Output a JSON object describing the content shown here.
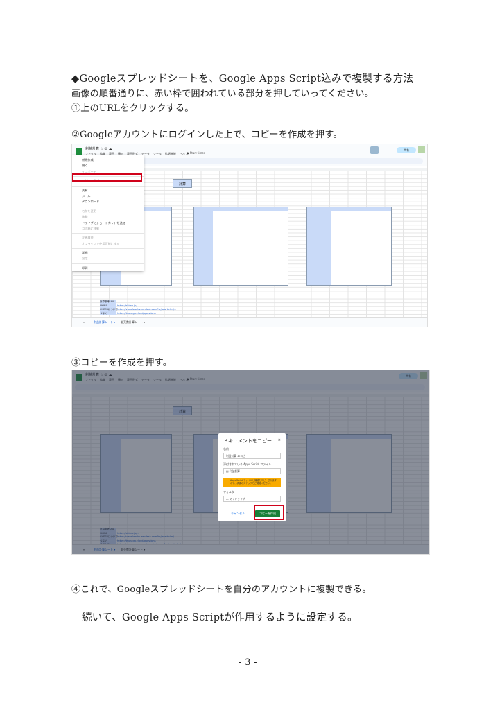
{
  "heading": "◆Googleスプレッドシートを、Google Apps Script込みで複製する方法",
  "intro": "画像の順番通りに、赤い枠で囲われている部分を押していってください。",
  "step1": "①上のURLをクリックする。",
  "step2": "②Googleアカウントにログインした上で、コピーを作成を押す。",
  "step3": "③コピーを作成を押す。",
  "step4": "④これで、Googleスプレッドシートを自分のアカウントに複製できる。",
  "next": "続いて、Google Apps Scriptが作用するように設定する。",
  "page_number": "- 3 -",
  "sheet": {
    "title": "利益計算 ☆ ⛁ ☁",
    "menus": [
      "ファイル",
      "編集",
      "表示",
      "挿入",
      "表示形式",
      "データ",
      "ツール",
      "拡張機能",
      "ヘルプ"
    ],
    "timer": "● Start timer",
    "share": "共有",
    "calc_button": "計算",
    "tabs": [
      "≡",
      "利益計算シート ▾",
      "販売数計算シート ▾"
    ],
    "url_rows": [
      {
        "label": "計算参考URL",
        "url": ""
      },
      {
        "label": "SKIMA",
        "url": "https://skima.jp/..."
      },
      {
        "label": "CHEERについて",
        "url": "https://visualworks.zendesk.com/hc/ja/articles/..."
      },
      {
        "label": "つなぐ",
        "url": "https://tsunagu.cloud/questions"
      },
      {
        "label": "ココナラ",
        "url": "https://coconala-support.zendesk.com/hc/ja/articles/..."
      }
    ]
  },
  "file_menu": [
    {
      "label": "新規作成",
      "shortcut": "▸"
    },
    {
      "label": "開く",
      "shortcut": "Ctrl+O"
    },
    {
      "label": "インポート",
      "shortcut": ""
    },
    {
      "label": "コピーを作成",
      "shortcut": ""
    },
    {
      "label": "共有",
      "shortcut": "▸"
    },
    {
      "label": "メール",
      "shortcut": "▸"
    },
    {
      "label": "ダウンロード",
      "shortcut": "▸"
    },
    {
      "label": "名前を変更",
      "shortcut": ""
    },
    {
      "label": "移動",
      "shortcut": ""
    },
    {
      "label": "ドライブにショートカットを追加",
      "shortcut": ""
    },
    {
      "label": "ゴミ箱に移動",
      "shortcut": ""
    },
    {
      "label": "変更履歴",
      "shortcut": "▸"
    },
    {
      "label": "オフラインで使用可能にする",
      "shortcut": ""
    },
    {
      "label": "詳細",
      "shortcut": ""
    },
    {
      "label": "設定",
      "shortcut": ""
    },
    {
      "label": "印刷",
      "shortcut": "Ctrl+P"
    }
  ],
  "copy_dialog": {
    "title": "ドキュメントをコピー",
    "close": "×",
    "name_label": "名前",
    "name_value": "利益計算 のコピー",
    "script_label": "添付されている Apps Script ファイル",
    "script_value": "▤ 利益計算",
    "warning": "Apps Script ファイルと機能もコピーされますので、承認のステップもご確認ください。",
    "folder_label": "フォルダ",
    "folder_value": "▭ マイドライブ",
    "cancel": "キャンセル",
    "ok": "コピーを作成"
  }
}
